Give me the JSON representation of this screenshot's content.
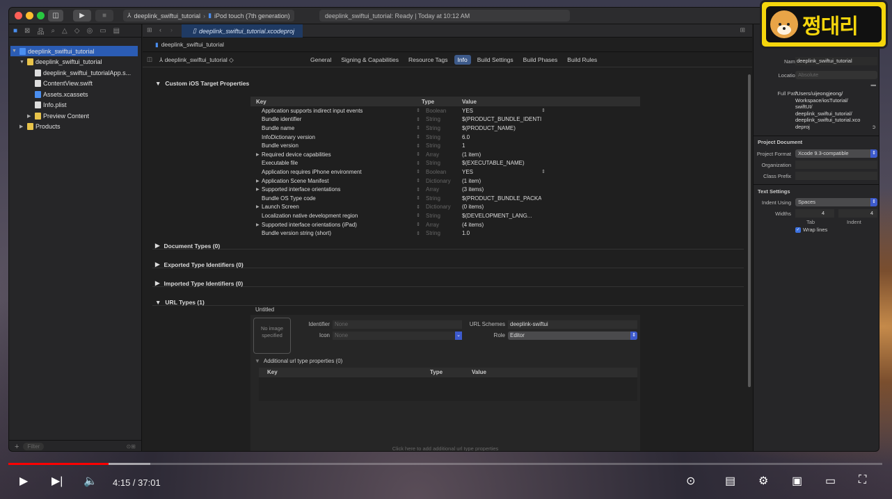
{
  "titlebar": {
    "scheme_project": "deeplink_swiftui_tutorial",
    "scheme_device": "iPod touch (7th generation)",
    "activity": "deeplink_swiftui_tutorial: Ready | Today at 10:12 AM"
  },
  "navigator": {
    "items": [
      {
        "label": "deeplink_swiftui_tutorial",
        "depth": 0,
        "icon": "project-icon",
        "open": true
      },
      {
        "label": "deeplink_swiftui_tutorial",
        "depth": 1,
        "icon": "folder-icon",
        "open": true
      },
      {
        "label": "deeplink_swiftui_tutorialApp.s...",
        "depth": 2,
        "icon": "file-icon"
      },
      {
        "label": "ContentView.swift",
        "depth": 2,
        "icon": "file-icon"
      },
      {
        "label": "Assets.xcassets",
        "depth": 2,
        "icon": "assets-icon"
      },
      {
        "label": "Info.plist",
        "depth": 2,
        "icon": "file-icon"
      },
      {
        "label": "Preview Content",
        "depth": 2,
        "icon": "folder-icon",
        "collapsed": true
      },
      {
        "label": "Products",
        "depth": 1,
        "icon": "folder-icon",
        "collapsed": true
      }
    ],
    "filter_placeholder": "Filter"
  },
  "editor": {
    "tab": "deeplink_swiftui_tutorial.xcodeproj",
    "jumpbar": "deeplink_swiftui_tutorial",
    "target": "deeplink_swiftui_tutorial",
    "tabs": [
      {
        "label": "General"
      },
      {
        "label": "Signing & Capabilities"
      },
      {
        "label": "Resource Tags"
      },
      {
        "label": "Info",
        "active": true
      },
      {
        "label": "Build Settings"
      },
      {
        "label": "Build Phases"
      },
      {
        "label": "Build Rules"
      }
    ],
    "custom_section": "Custom iOS Target Properties",
    "plist_headers": {
      "key": "Key",
      "type": "Type",
      "value": "Value"
    },
    "plist_rows": [
      {
        "key": "Application supports indirect input events",
        "type": "Boolean",
        "value": "YES"
      },
      {
        "key": "Bundle identifier",
        "type": "String",
        "value": "$(PRODUCT_BUNDLE_IDENTIFI"
      },
      {
        "key": "Bundle name",
        "type": "String",
        "value": "$(PRODUCT_NAME)"
      },
      {
        "key": "InfoDictionary version",
        "type": "String",
        "value": "6.0"
      },
      {
        "key": "Bundle version",
        "type": "String",
        "value": "1"
      },
      {
        "key": "Required device capabilities",
        "type": "Array",
        "value": "(1 item)",
        "expand": true
      },
      {
        "key": "Executable file",
        "type": "String",
        "value": "$(EXECUTABLE_NAME)"
      },
      {
        "key": "Application requires iPhone environment",
        "type": "Boolean",
        "value": "YES"
      },
      {
        "key": "Application Scene Manifest",
        "type": "Dictionary",
        "value": "(1 item)",
        "expand": true
      },
      {
        "key": "Supported interface orientations",
        "type": "Array",
        "value": "(3 items)",
        "expand": true
      },
      {
        "key": "Bundle OS Type code",
        "type": "String",
        "value": "$(PRODUCT_BUNDLE_PACKAG"
      },
      {
        "key": "Launch Screen",
        "type": "Dictionary",
        "value": "(0 items)",
        "expand": true
      },
      {
        "key": "Localization native development region",
        "type": "String",
        "value": "$(DEVELOPMENT_LANG..."
      },
      {
        "key": "Supported interface orientations (iPad)",
        "type": "Array",
        "value": "(4 items)",
        "expand": true
      },
      {
        "key": "Bundle version string (short)",
        "type": "String",
        "value": "1.0"
      }
    ],
    "sections": [
      "Document Types (0)",
      "Exported Type Identifiers (0)",
      "Imported Type Identifiers (0)",
      "URL Types (1)"
    ],
    "url_type": {
      "name": "Untitled",
      "no_image": "No image specified",
      "identifier_label": "Identifier",
      "identifier_placeholder": "None",
      "icon_label": "Icon",
      "icon_placeholder": "None",
      "schemes_label": "URL Schemes",
      "schemes_value": "deeplink-swiftui",
      "role_label": "Role",
      "role_value": "Editor",
      "additional": "Additional url type properties (0)",
      "add_hint": "Click here to add additional url type properties"
    }
  },
  "inspector": {
    "name_label": "Name",
    "name_value": "deeplink_swiftui_tutorial",
    "location_label": "Location",
    "location_value": "Absolute",
    "fullpath_label": "Full Path",
    "fullpath_value": [
      "/Users/uijeongjeong/",
      "Workspace/iosTutorial/",
      "swiftUI/",
      "deeplink_swiftui_tutorial/",
      "deeplink_swiftui_tutorial.xco",
      "deproj"
    ],
    "project_document": "Project Document",
    "format_label": "Project Format",
    "format_value": "Xcode 9.3-compatible",
    "org_label": "Organization",
    "class_label": "Class Prefix",
    "text_settings": "Text Settings",
    "indent_label": "Indent Using",
    "indent_value": "Spaces",
    "widths_label": "Widths",
    "tab_width": "4",
    "indent_width": "4",
    "tab_caption": "Tab",
    "indent_caption": "Indent",
    "wrap_label": "Wrap lines"
  },
  "badge": {
    "text": "쩡대리"
  },
  "player": {
    "time": "4:15 / 37:01",
    "played_fraction": 0.115
  }
}
